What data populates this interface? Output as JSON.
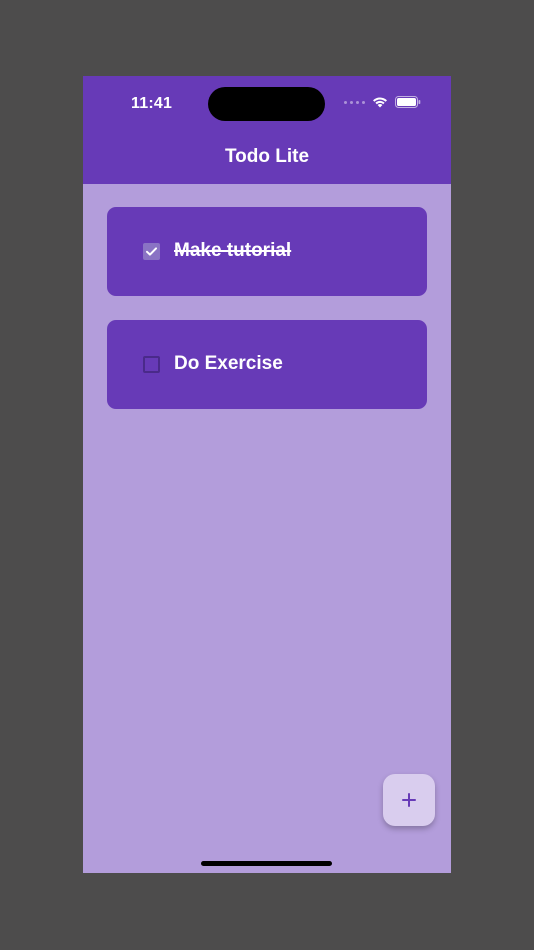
{
  "status_bar": {
    "time": "11:41",
    "icons": [
      "signal-icon",
      "wifi-icon",
      "battery-icon"
    ]
  },
  "app_bar": {
    "title": "Todo Lite"
  },
  "todos": [
    {
      "label": "Make tutorial",
      "completed": true
    },
    {
      "label": "Do Exercise",
      "completed": false
    }
  ],
  "fab": {
    "icon": "plus-icon"
  },
  "colors": {
    "primary": "#673ab7",
    "background": "#b39ddb",
    "fab": "#d9cdee",
    "outer_frame": "#4d4c4c"
  }
}
